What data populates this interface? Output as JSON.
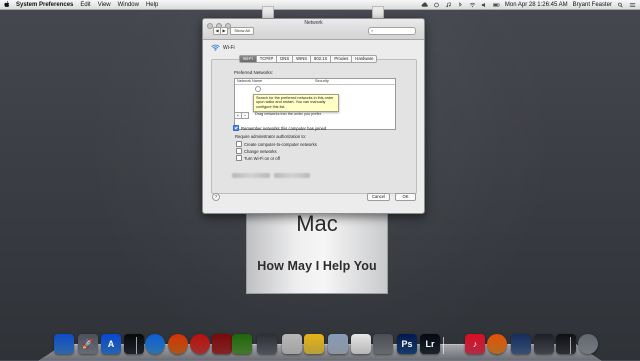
{
  "menubar": {
    "app": "System Preferences",
    "items": [
      "Edit",
      "View",
      "Window",
      "Help"
    ],
    "clock": "Mon Apr 28  1:26:45 AM",
    "user": "Bryant Feaster"
  },
  "window": {
    "title": "Network",
    "show_all": "Show All",
    "back": "◀",
    "forward": "▶",
    "search_placeholder": "",
    "interface_label": "Wi-Fi",
    "tabs": [
      "Wi-Fi",
      "TCP/IP",
      "DNS",
      "WINS",
      "802.1X",
      "Proxies",
      "Hardware"
    ],
    "active_tab": "Wi-Fi",
    "preferred_label": "Preferred Networks:",
    "table_headers": [
      "Network Name",
      "Security"
    ],
    "tooltip": "Search for the preferred networks in this order upon wake and restart. You can manually configure this list.",
    "add": "+",
    "remove": "−",
    "drag_hint": "Drag networks into the order you prefer.",
    "remember_label": "Remember networks this computer has joined",
    "remember_checked": true,
    "require_label": "Require administrator authorization to:",
    "options": [
      "Create computer-to-computer networks",
      "Change networks",
      "Turn Wi-Fi on or off"
    ],
    "help": "?",
    "cancel": "Cancel",
    "ok": "OK"
  },
  "sign": {
    "title": "Mac",
    "tagline": "How May I Help You"
  },
  "dock": {
    "icons": [
      {
        "name": "finder",
        "color": "#3d8be0",
        "glyph": ""
      },
      {
        "name": "launchpad",
        "color": "#8a8f99",
        "glyph": "🚀"
      },
      {
        "name": "app-store",
        "color": "#2f86e6",
        "glyph": "A"
      },
      {
        "name": "mission-control",
        "color": "#2a2f38",
        "glyph": ""
      },
      {
        "name": "safari",
        "color": "#3b9ae8",
        "glyph": ""
      },
      {
        "name": "firefox",
        "color": "#e8731f",
        "glyph": ""
      },
      {
        "name": "chrome",
        "color": "#d9413b",
        "glyph": ""
      },
      {
        "name": "app-red",
        "color": "#b03030",
        "glyph": ""
      },
      {
        "name": "evernote",
        "color": "#5aa03a",
        "glyph": ""
      },
      {
        "name": "app-gray",
        "color": "#6b6e75",
        "glyph": ""
      },
      {
        "name": "printer",
        "color": "#d8d8d8",
        "glyph": ""
      },
      {
        "name": "stickies",
        "color": "#f3d54a",
        "glyph": ""
      },
      {
        "name": "mail",
        "color": "#b9c7d8",
        "glyph": ""
      },
      {
        "name": "calendar",
        "color": "#f2f2f2",
        "glyph": ""
      },
      {
        "name": "system-preferences",
        "color": "#8a8d93",
        "glyph": ""
      },
      {
        "name": "photoshop",
        "color": "#1d4f8c",
        "glyph": "Ps"
      },
      {
        "name": "lightroom",
        "color": "#23303f",
        "glyph": "Lr"
      },
      {
        "name": "itunes",
        "color": "#ec3a5c",
        "glyph": "♪"
      },
      {
        "name": "ibooks",
        "color": "#f0902a",
        "glyph": ""
      },
      {
        "name": "preview",
        "color": "#4a6a9a",
        "glyph": ""
      },
      {
        "name": "imovie",
        "color": "#575b63",
        "glyph": ""
      },
      {
        "name": "app-dark",
        "color": "#3c3f46",
        "glyph": ""
      },
      {
        "name": "trash",
        "color": "#9ea3aa",
        "glyph": ""
      }
    ]
  }
}
